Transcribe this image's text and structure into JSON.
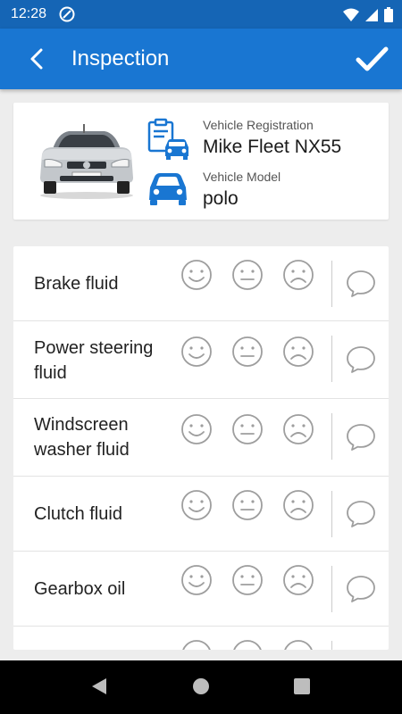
{
  "status_bar": {
    "time": "12:28",
    "icons": [
      "at-icon",
      "wifi-icon",
      "signal-icon",
      "battery-icon"
    ]
  },
  "app_bar": {
    "title": "Inspection",
    "back_icon": "arrow-back-icon",
    "confirm_icon": "check-icon"
  },
  "vehicle": {
    "registration_label": "Vehicle Registration",
    "registration_value": "Mike Fleet NX55",
    "model_label": "Vehicle Model",
    "model_value": "polo"
  },
  "inspection_items": [
    {
      "label": "Brake fluid"
    },
    {
      "label": "Power steering fluid"
    },
    {
      "label": "Windscreen washer fluid"
    },
    {
      "label": "Clutch fluid"
    },
    {
      "label": "Gearbox oil"
    },
    {
      "label": ""
    }
  ],
  "rating_icons": [
    "happy-face-icon",
    "neutral-face-icon",
    "sad-face-icon",
    "comment-icon"
  ],
  "colors": {
    "accent": "#1976d2",
    "status_bar": "#1565b5",
    "icon_grey": "#9e9e9e",
    "vehicle_icon_blue": "#1976d2"
  }
}
